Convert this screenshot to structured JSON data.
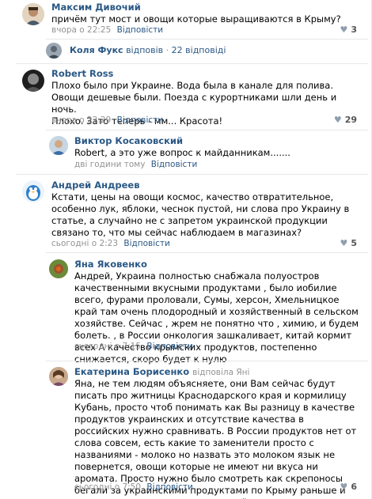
{
  "comments": [
    {
      "author": "Максим Дивочий",
      "text": "причём тут мост и овощи которые выращиваются в Крыму?",
      "time": "вчора о 22:25",
      "reply_label": "Відповісти",
      "likes": "3"
    },
    {
      "author": "Robert Ross",
      "text": "Плохо было при Украине. Вода была в канале для полива. Овощи дешевые были. Поезда с курортниками шли день и ночь.\nПлохо. Зато теперь - мм... Красота!",
      "time": "вчора о 22:29",
      "reply_label": "Відповісти",
      "likes": "29"
    },
    {
      "author": "Виктор Косаковский",
      "text": "Robert, а это уже вопрос к майданникам.......",
      "time": "дві години тому",
      "reply_label": "Відповісти"
    },
    {
      "author": "Андрей Андреев",
      "text": "Кстати, цены на овощи космос, качество отвратительное, особенно лук, яблоки, чеснок пустой, ни слова про Украину в статье, а случайно не с запретом украинской продукции связано то, что мы сейчас наблюдаем в магазинах?",
      "time": "сьогодні о 2:23",
      "reply_label": "Відповісти",
      "likes": "5"
    },
    {
      "author": "Яна Яковенко",
      "text": "Андрей, Украина полностью снабжала полуостров качественными вкусными продуктами , было иобилие всего, фурами проловали, Сумы, херсон, Хмельницкое край там очень плодородный и хозяйственный в сельском хозяйстве. Сейчас , жрем не понятно что , химию, и будем болеть. , в России онкология зашкаливает, китай кормит всех А качество крымских продуктов, постепенно снижается, скоро будет к нулю",
      "time": "сьогодні о 7:15",
      "reply_label": "Відповісти"
    },
    {
      "author": "Екатерина Борисенко",
      "reply_to": "відповіла Яні",
      "text": "Яна, не тем людям объясняете, они Вам сейчас будут писать про житницы Краснодарского края и кормилицу Кубань, просто чтоб понимать как Вы разницу в качестве продуктов украинских и отсутствие качества в российских нужно сравнивать. В России продуктов нет от слова совсем, есть какие то заменители просто с названиями - молоко но назвать это молоком язык не повернется, овощи которые не имеют ни вкуса ни аромата. Просто нужно было смотреть как скрепоносы бегали за украинскими продуктами по Крыму раньше и выскакивали из поездов на каждой станции.",
      "time": "сьогодні о 7:50",
      "reply_label": "Відповісти",
      "likes": "6"
    }
  ],
  "thread": {
    "author": "Коля Фукс",
    "action": "відповів",
    "separator": "·",
    "count": "22 відповіді"
  }
}
